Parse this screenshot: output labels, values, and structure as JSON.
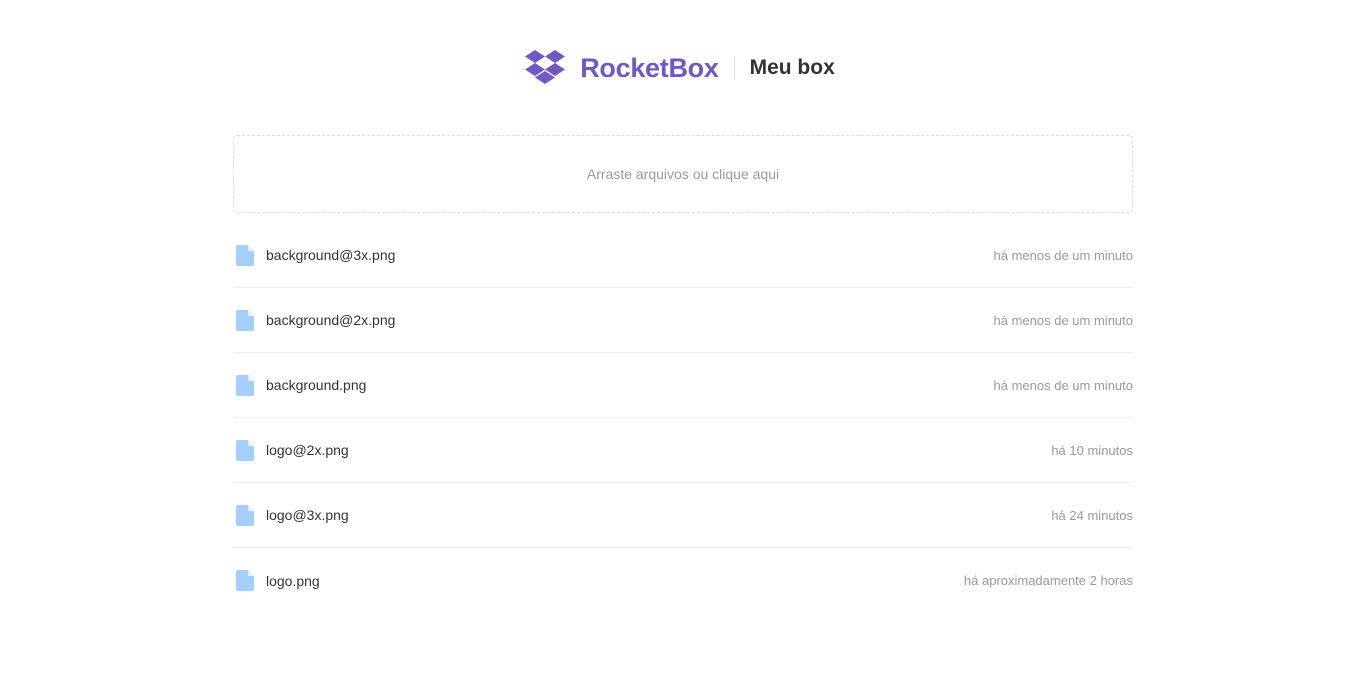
{
  "header": {
    "logo_icon": "dropbox-box-icon",
    "brand_name": "RocketBox",
    "box_title": "Meu box",
    "brand_color": "#7159c1"
  },
  "dropzone": {
    "label": "Arraste arquivos ou clique aqui"
  },
  "files": [
    {
      "icon": "file-icon",
      "name": "background@3x.png",
      "time": "há menos de um minuto"
    },
    {
      "icon": "file-icon",
      "name": "background@2x.png",
      "time": "há menos de um minuto"
    },
    {
      "icon": "file-icon",
      "name": "background.png",
      "time": "há menos de um minuto"
    },
    {
      "icon": "file-icon",
      "name": "logo@2x.png",
      "time": "há 10 minutos"
    },
    {
      "icon": "file-icon",
      "name": "logo@3x.png",
      "time": "há 24 minutos"
    },
    {
      "icon": "file-icon",
      "name": "logo.png",
      "time": "há aproximadamente 2 horas"
    }
  ],
  "colors": {
    "file_icon": "#a5cffe",
    "muted_text": "#999999",
    "divider": "#eeeeee"
  }
}
